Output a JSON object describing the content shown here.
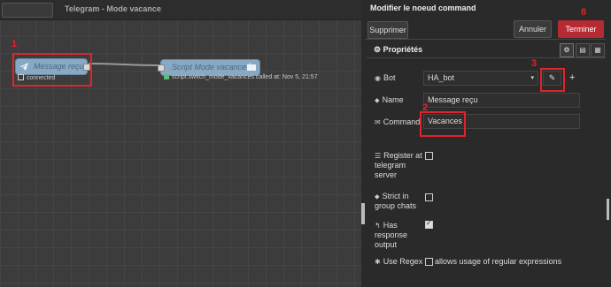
{
  "workspace": {
    "search": "",
    "flow_tab_title": "Telegram - Mode vacance:",
    "nodes": [
      {
        "label": "Message reçu",
        "status": "connected",
        "status_color": "#ffffff"
      },
      {
        "label": "Script Mode vacances",
        "status": "script.switch_mode_vacances called at: Nov 5, 21:57",
        "status_color": "#5fba7d"
      }
    ]
  },
  "editor": {
    "title": "Modifier le noeud command",
    "delete_label": "Supprimer",
    "cancel_label": "Annuler",
    "done_label": "Terminer",
    "props_tab_label": "Propriétés",
    "bot": {
      "label": "Bot",
      "value": "HA_bot"
    },
    "name": {
      "label": "Name",
      "value": "Message reçu"
    },
    "command": {
      "label": "Command",
      "value": "Vacances"
    },
    "register": {
      "label": "Register at telegram server",
      "checked": false
    },
    "strict": {
      "label": "Strict in group chats",
      "checked": false
    },
    "response": {
      "label": "Has response output",
      "checked": true
    },
    "regex": {
      "label": "Use Regex",
      "checked": false,
      "hint": "allows usage of regular expressions"
    }
  },
  "annotations": [
    "1",
    "2",
    "3",
    "8"
  ],
  "colors": {
    "accent_red": "#e1232b",
    "done_button": "#b52a33",
    "node_fill": "#87a9c4"
  }
}
